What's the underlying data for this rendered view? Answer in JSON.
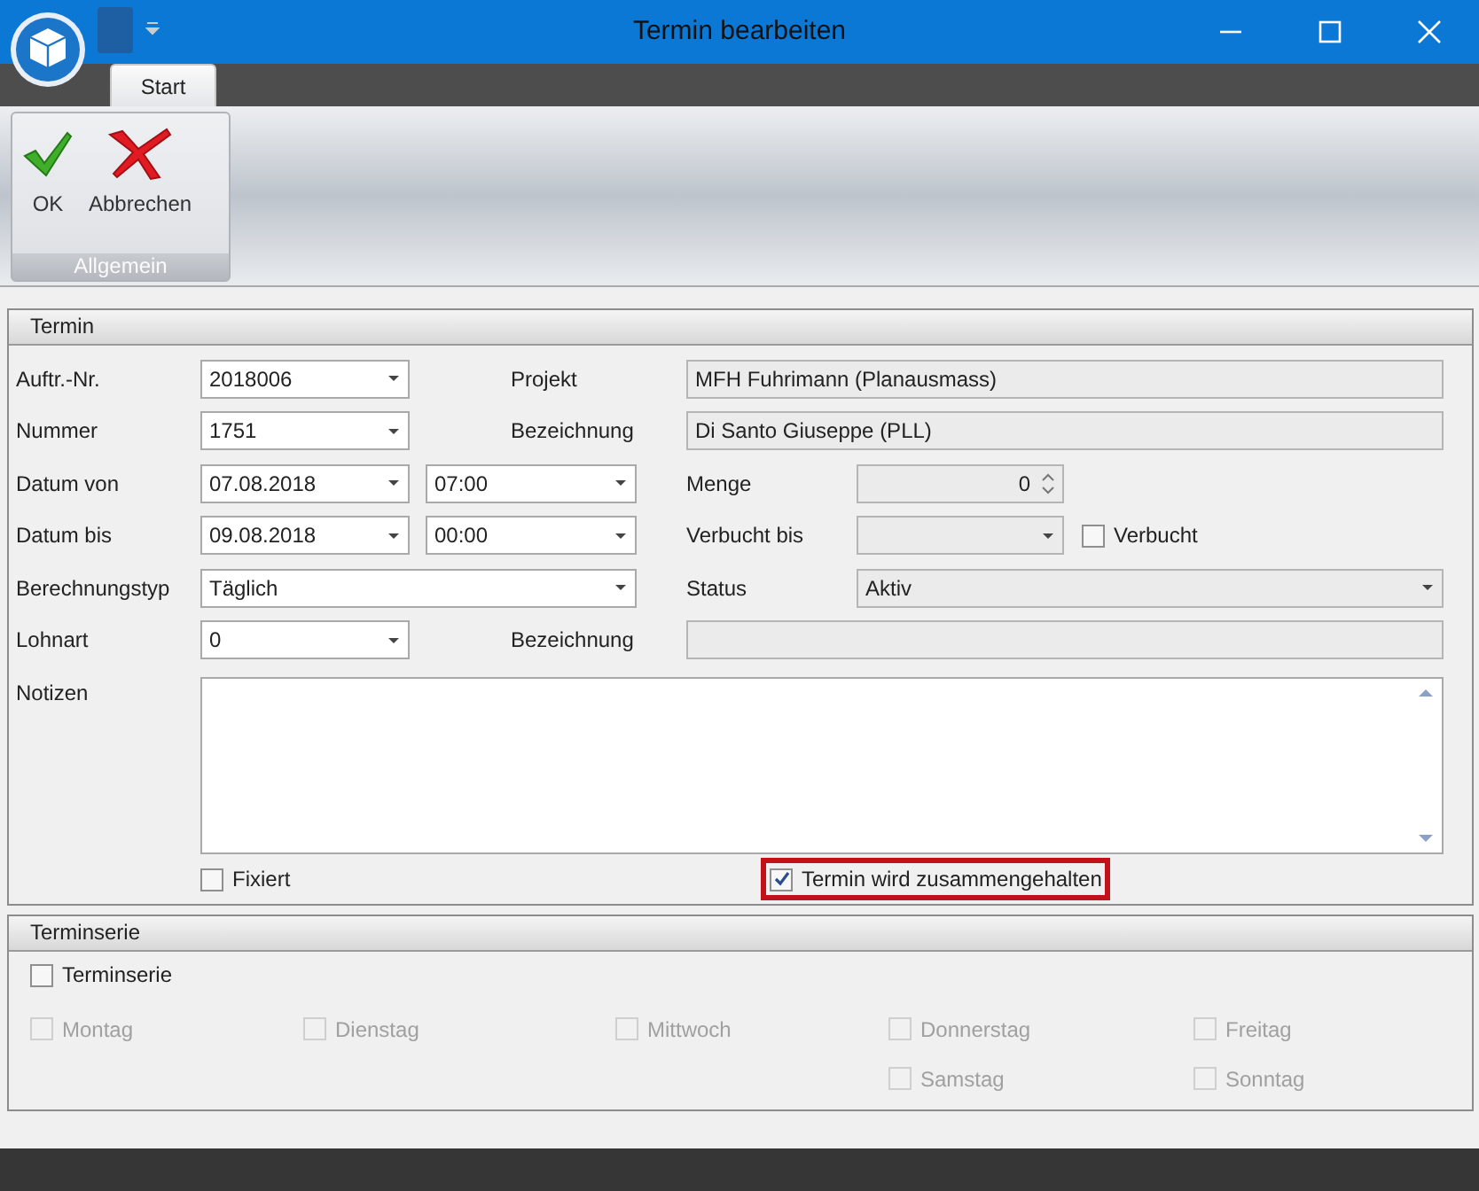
{
  "window": {
    "title": "Termin bearbeiten"
  },
  "ribbon": {
    "tabs": [
      {
        "label": "Start",
        "selected": true
      }
    ],
    "groups": [
      {
        "label": "Allgemein",
        "buttons": [
          {
            "label": "OK",
            "kind": "ok"
          },
          {
            "label": "Abbrechen",
            "kind": "cancel"
          }
        ]
      }
    ]
  },
  "termin": {
    "title": "Termin",
    "auftr_nr": {
      "label": "Auftr.-Nr.",
      "value": "2018006"
    },
    "projekt": {
      "label": "Projekt",
      "value": "MFH Fuhrimann (Planausmass)"
    },
    "nummer": {
      "label": "Nummer",
      "value": "1751"
    },
    "bezeichnung": {
      "label": "Bezeichnung",
      "value": "Di Santo Giuseppe (PLL)"
    },
    "datum_von": {
      "label": "Datum von",
      "date": "07.08.2018",
      "time": "07:00"
    },
    "menge": {
      "label": "Menge",
      "value": "0"
    },
    "datum_bis": {
      "label": "Datum bis",
      "date": "09.08.2018",
      "time": "00:00"
    },
    "verbucht_bis": {
      "label": "Verbucht bis"
    },
    "verbucht": {
      "label": "Verbucht",
      "checked": false
    },
    "berechnungstyp": {
      "label": "Berechnungstyp",
      "value": "Täglich"
    },
    "status": {
      "label": "Status",
      "value": "Aktiv"
    },
    "lohnart": {
      "label": "Lohnart",
      "value": "0"
    },
    "bezeichnung_2": {
      "label": "Bezeichnung"
    },
    "notizen": {
      "label": "Notizen"
    },
    "fixiert": {
      "label": "Fixiert",
      "checked": false
    },
    "zusammengehalten": {
      "label": "Termin wird zusammengehalten",
      "checked": true,
      "highlighted": true
    }
  },
  "terminserie": {
    "title": "Terminserie",
    "serie": {
      "label": "Terminserie",
      "checked": false
    },
    "days": [
      {
        "label": "Montag",
        "checked": false,
        "disabled": true
      },
      {
        "label": "Dienstag",
        "checked": false,
        "disabled": true
      },
      {
        "label": "Mittwoch",
        "checked": false,
        "disabled": true
      },
      {
        "label": "Donnerstag",
        "checked": false,
        "disabled": true
      },
      {
        "label": "Freitag",
        "checked": false,
        "disabled": true
      },
      {
        "label": "Samstag",
        "checked": false,
        "disabled": true
      },
      {
        "label": "Sonntag",
        "checked": false,
        "disabled": true
      }
    ]
  }
}
